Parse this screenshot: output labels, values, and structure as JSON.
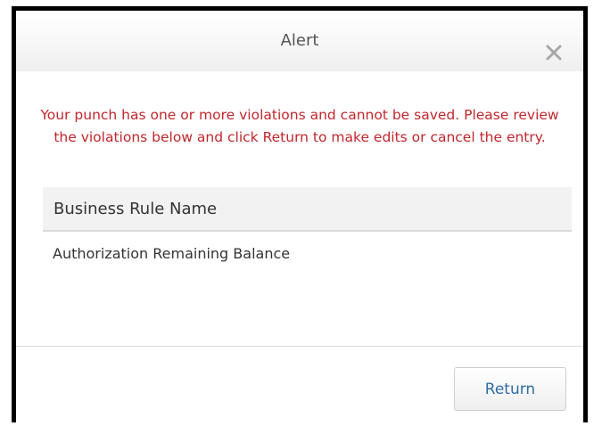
{
  "dialog": {
    "title": "Alert",
    "close_icon": "close-x-icon",
    "message": "Your punch has one or more violations and cannot be saved. Please review the violations below and click Return to make edits or cancel the entry.",
    "table": {
      "column_header": "Business Rule Name",
      "rows": [
        "Authorization Remaining Balance"
      ]
    },
    "return_label": "Return"
  },
  "colors": {
    "message_text": "#c0272d",
    "button_text": "#2e6da4",
    "table_header_bg": "#f2f2f2"
  }
}
